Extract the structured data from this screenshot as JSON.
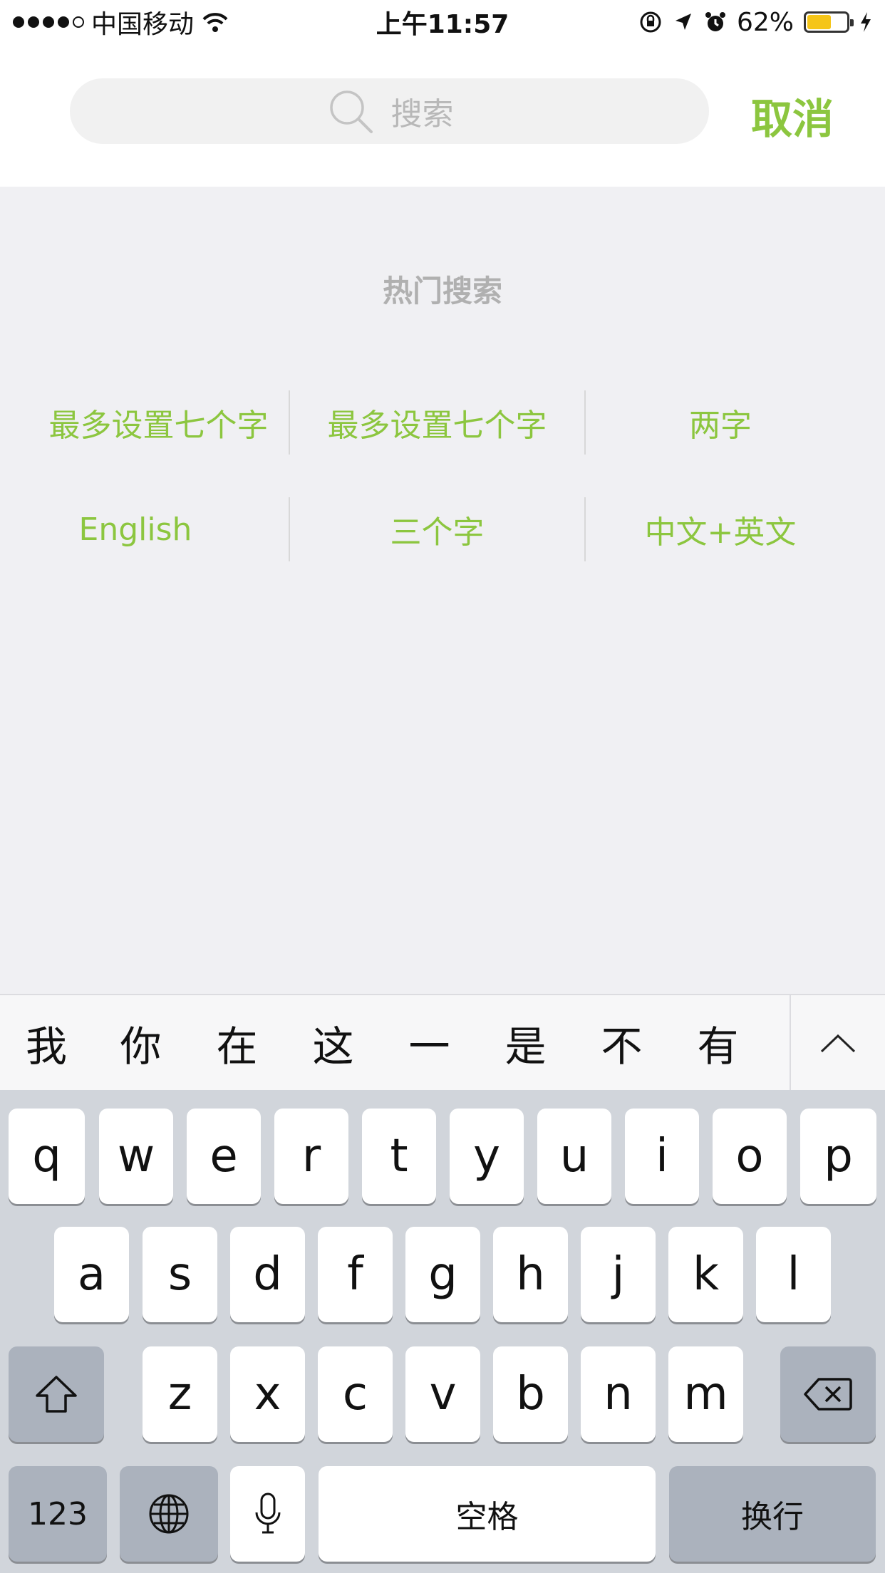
{
  "status_bar": {
    "carrier": "中国移动",
    "time": "上午11:57",
    "battery": "62%"
  },
  "search": {
    "placeholder": "搜索",
    "cancel": "取消"
  },
  "hot": {
    "title": "热门搜索",
    "rows": [
      [
        "最多设置七个字",
        "最多设置七个字",
        "两字"
      ],
      [
        "English",
        "三个字",
        "中文+英文"
      ]
    ]
  },
  "keyboard": {
    "candidates": [
      "我",
      "你",
      "在",
      "这",
      "一",
      "是",
      "不",
      "有"
    ],
    "row1": [
      "q",
      "w",
      "e",
      "r",
      "t",
      "y",
      "u",
      "i",
      "o",
      "p"
    ],
    "row2": [
      "a",
      "s",
      "d",
      "f",
      "g",
      "h",
      "j",
      "k",
      "l"
    ],
    "row3": [
      "z",
      "x",
      "c",
      "v",
      "b",
      "n",
      "m"
    ],
    "numbers": "123",
    "space": "空格",
    "return": "换行"
  },
  "colors": {
    "accent": "#8cc63f",
    "battery": "#f5c518"
  }
}
